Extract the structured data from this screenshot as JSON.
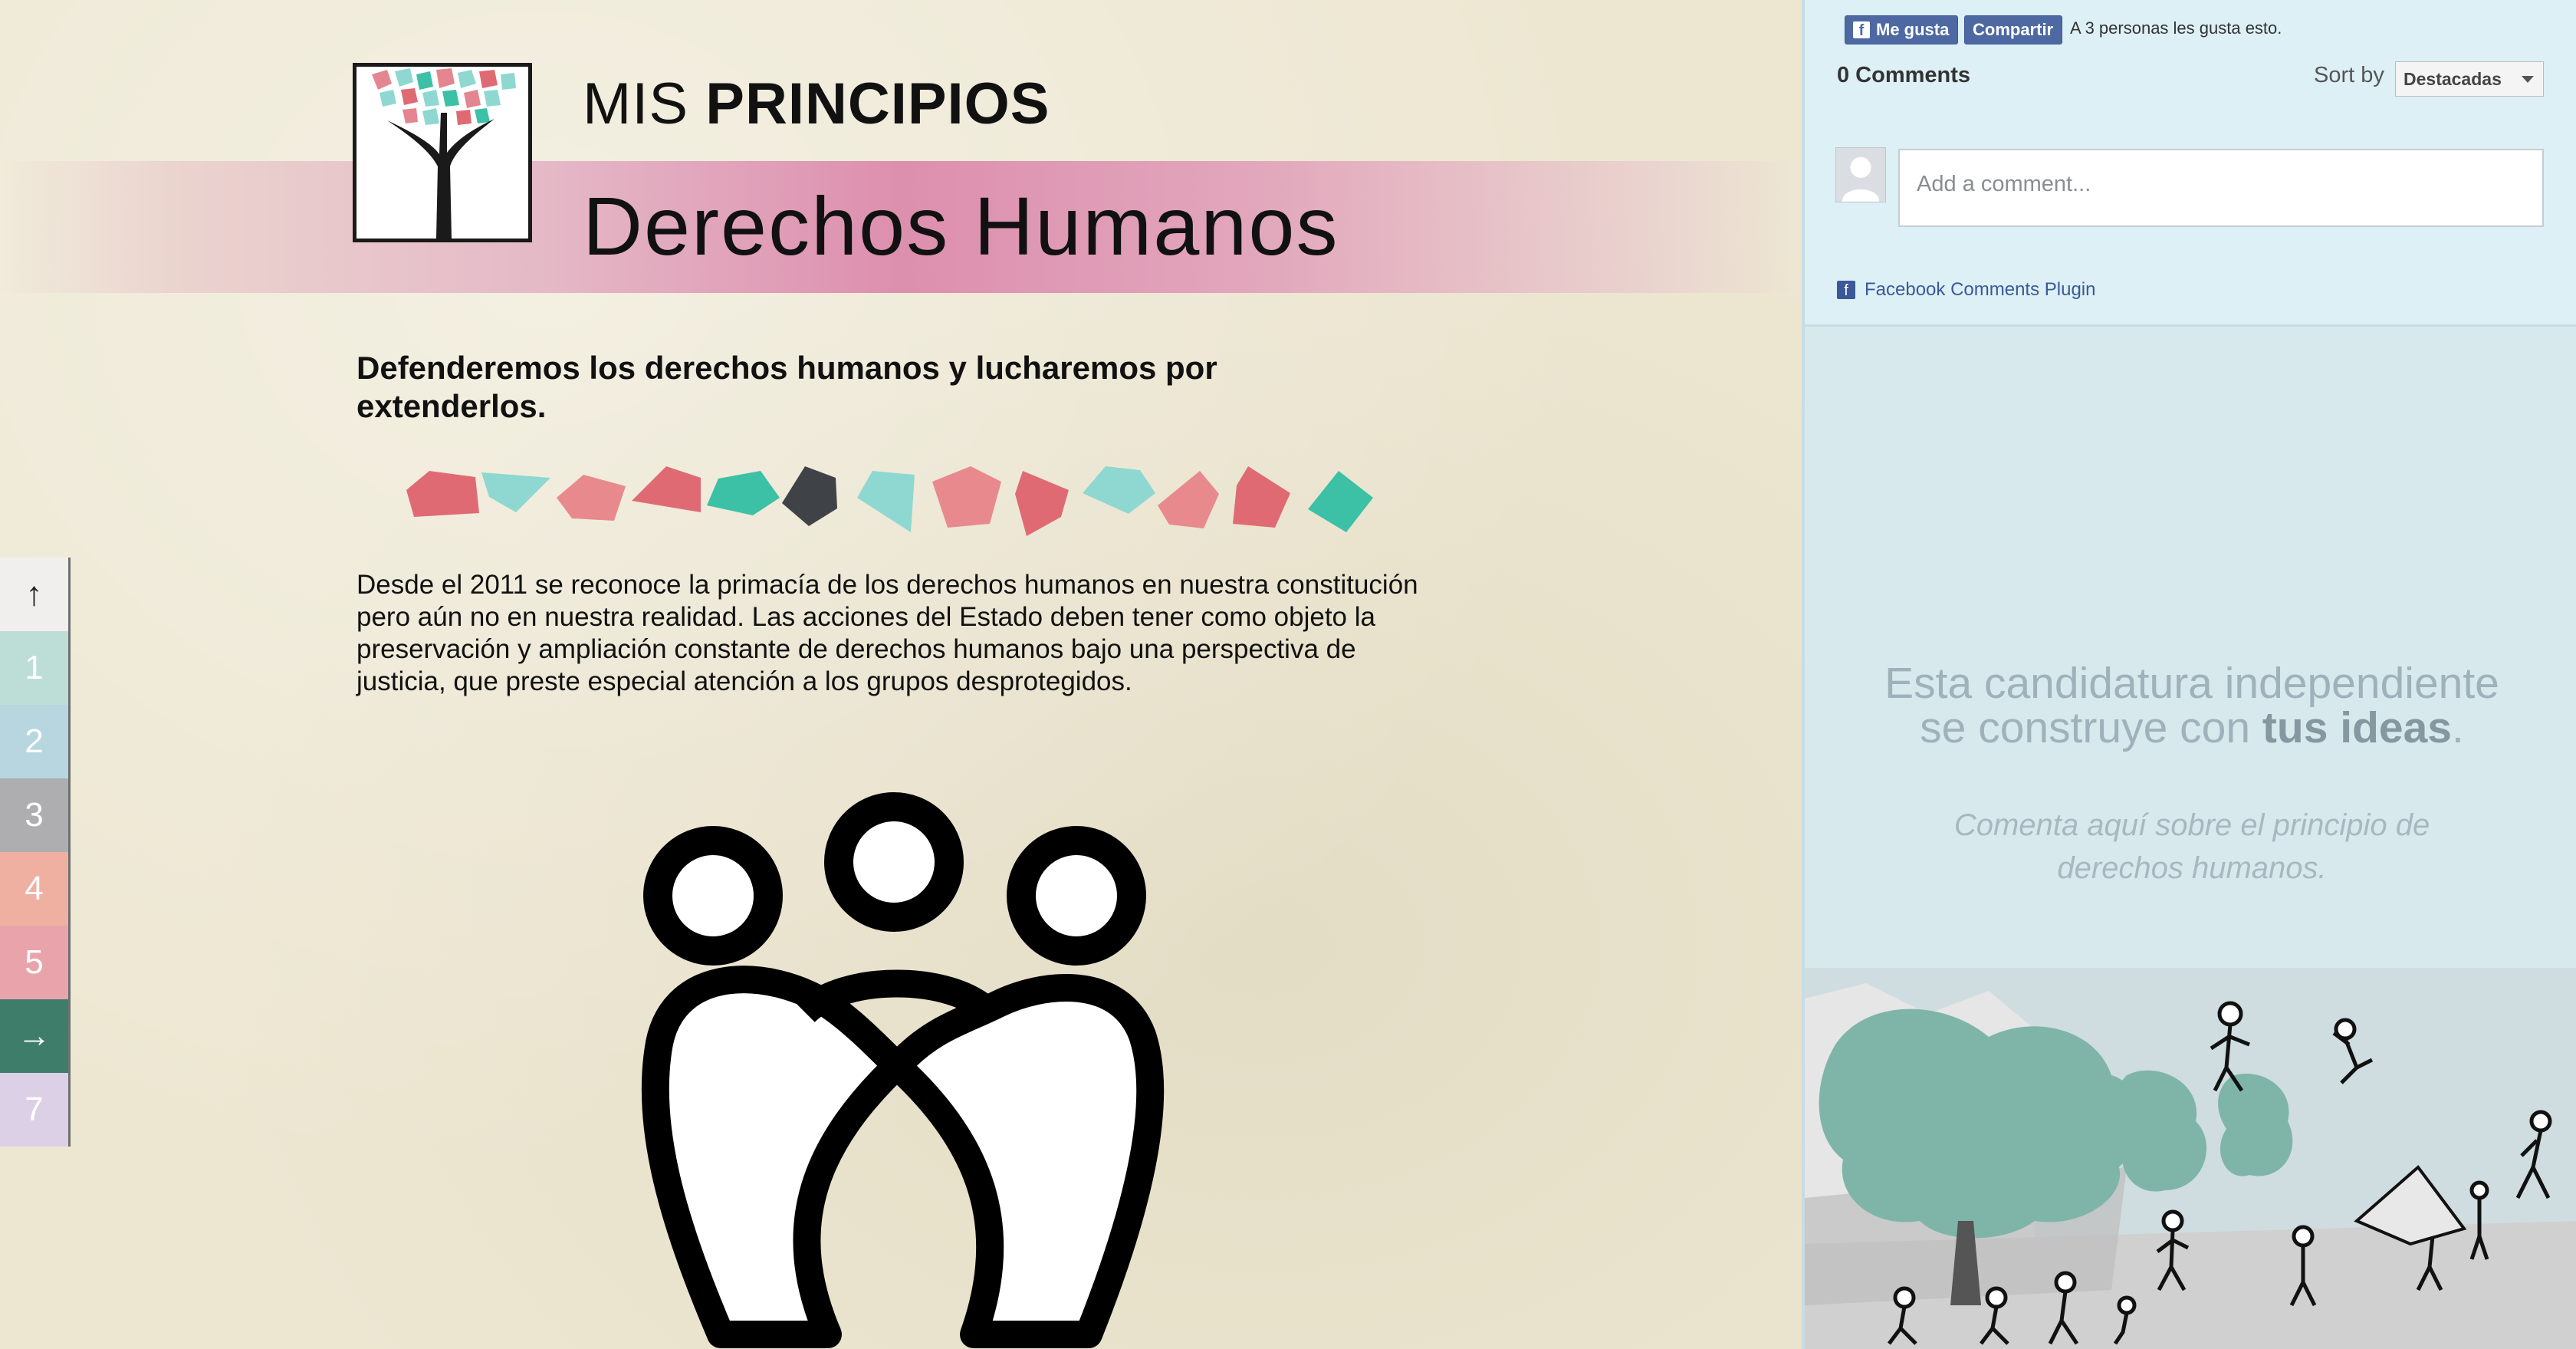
{
  "header": {
    "small_title_prefix": "MIS",
    "small_title_bold": "PRINCIPIOS",
    "page_title": "Derechos Humanos"
  },
  "content": {
    "lead": "Defenderemos los derechos humanos y lucharemos por extenderlos.",
    "body": "Desde el 2011 se reconoce la primacía de los derechos humanos en nuestra constitución pero aún no en nuestra realidad. Las acciones del Estado deben tener como objeto la preservación y ampliación constante de derechos humanos bajo una perspectiva de justicia, que preste especial atención a los grupos desprotegidos."
  },
  "sidenav": {
    "items": [
      {
        "label": "↑",
        "color": "#f0efed",
        "text_color": "#222",
        "icon": "up-arrow-icon"
      },
      {
        "label": "1",
        "color": "#bcded6"
      },
      {
        "label": "2",
        "color": "#b7d6e0"
      },
      {
        "label": "3",
        "color": "#aeadb0"
      },
      {
        "label": "4",
        "color": "#efb0a2"
      },
      {
        "label": "5",
        "color": "#e9a4ab"
      },
      {
        "label": "→",
        "color": "#3f7d6b",
        "icon": "right-arrow-icon"
      },
      {
        "label": "7",
        "color": "#dcd0e6"
      }
    ]
  },
  "gems": {
    "colors": [
      "#e06a73",
      "#8ed8d1",
      "#e88a8d",
      "#e06a73",
      "#3cc0a6",
      "#3f4246",
      "#8ed8d1",
      "#e88a8d",
      "#e06a73",
      "#8ed8d1",
      "#e88a8d",
      "#e06a73",
      "#3cc0a6"
    ]
  },
  "facebook": {
    "like_label": "Me gusta",
    "share_label": "Compartir",
    "like_count_text": "A 3 personas les gusta esto.",
    "comments_count": "0 Comments",
    "sort_label": "Sort by",
    "sort_value": "Destacadas",
    "comment_placeholder": "Add a comment...",
    "plugin_label": "Facebook Comments Plugin"
  },
  "cta": {
    "line1": "Esta candidatura independiente",
    "line2_prefix": "se construye con ",
    "line2_bold": "tus ideas",
    "line2_suffix": ".",
    "sub": "Comenta aquí sobre el principio de derechos humanos."
  },
  "colors": {
    "background": "#ede7d2",
    "band_pink": "#dd8fae",
    "right_panel": "#d7e9ec",
    "fb_blue": "#4e69a2"
  }
}
